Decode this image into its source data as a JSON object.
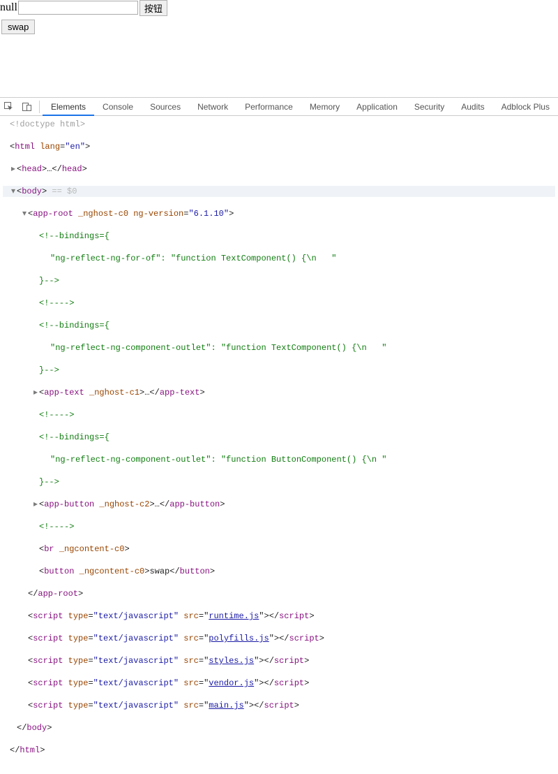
{
  "top": {
    "null_label": "null",
    "input_value": "",
    "btn_label": "按钮",
    "swap_label": "swap"
  },
  "devtools": {
    "tabs": [
      "Elements",
      "Console",
      "Sources",
      "Network",
      "Performance",
      "Memory",
      "Application",
      "Security",
      "Audits",
      "Adblock Plus"
    ],
    "active_tab_index": 0,
    "source_lines": [
      {
        "ind": 0,
        "caret": "",
        "seg": [
          {
            "c": "cgray",
            "t": "<!doctype html>"
          }
        ]
      },
      {
        "ind": 0,
        "caret": "",
        "seg": [
          {
            "c": "",
            "t": "<"
          },
          {
            "c": "ctag",
            "t": "html"
          },
          {
            "c": "",
            "t": " "
          },
          {
            "c": "cattrname",
            "t": "lang"
          },
          {
            "c": "",
            "t": "="
          },
          {
            "c": "cattrval",
            "t": "\"en\""
          },
          {
            "c": "",
            "t": ">"
          }
        ]
      },
      {
        "ind": 1,
        "caret": "▸",
        "seg": [
          {
            "c": "",
            "t": "<"
          },
          {
            "c": "ctag",
            "t": "head"
          },
          {
            "c": "",
            "t": ">…</"
          },
          {
            "c": "ctag",
            "t": "head"
          },
          {
            "c": "",
            "t": ">"
          }
        ]
      },
      {
        "ind": 1,
        "caret": "▾",
        "hl": true,
        "seg": [
          {
            "c": "",
            "t": "<"
          },
          {
            "c": "ctag",
            "t": "body"
          },
          {
            "c": "",
            "t": ">"
          },
          {
            "c": "sel-dim",
            "t": " == $0"
          }
        ]
      },
      {
        "ind": 2,
        "caret": "▾",
        "seg": [
          {
            "c": "",
            "t": "<"
          },
          {
            "c": "ctag",
            "t": "app-root"
          },
          {
            "c": "",
            "t": " "
          },
          {
            "c": "cattrname",
            "t": "_nghost-c0"
          },
          {
            "c": "",
            "t": " "
          },
          {
            "c": "cattrname",
            "t": "ng-version"
          },
          {
            "c": "",
            "t": "="
          },
          {
            "c": "cattrval",
            "t": "\"6.1.10\""
          },
          {
            "c": "",
            "t": ">"
          }
        ]
      },
      {
        "ind": 3,
        "caret": "",
        "seg": [
          {
            "c": "ccomment",
            "t": "<!--bindings={"
          }
        ]
      },
      {
        "ind": 4,
        "caret": "",
        "seg": [
          {
            "c": "ccomment",
            "t": "\"ng-reflect-ng-for-of\": \"function TextComponent() {\\n   \""
          }
        ]
      },
      {
        "ind": 3,
        "caret": "",
        "seg": [
          {
            "c": "ccomment",
            "t": "}-->"
          }
        ]
      },
      {
        "ind": 3,
        "caret": "",
        "seg": [
          {
            "c": "ccomment",
            "t": "<!---->"
          }
        ]
      },
      {
        "ind": 3,
        "caret": "",
        "seg": [
          {
            "c": "ccomment",
            "t": "<!--bindings={"
          }
        ]
      },
      {
        "ind": 4,
        "caret": "",
        "seg": [
          {
            "c": "ccomment",
            "t": "\"ng-reflect-ng-component-outlet\": \"function TextComponent() {\\n   \""
          }
        ]
      },
      {
        "ind": 3,
        "caret": "",
        "seg": [
          {
            "c": "ccomment",
            "t": "}-->"
          }
        ]
      },
      {
        "ind": 3,
        "caret": "▸",
        "seg": [
          {
            "c": "",
            "t": "<"
          },
          {
            "c": "ctag",
            "t": "app-text"
          },
          {
            "c": "",
            "t": " "
          },
          {
            "c": "cattrname",
            "t": "_nghost-c1"
          },
          {
            "c": "",
            "t": ">…</"
          },
          {
            "c": "ctag",
            "t": "app-text"
          },
          {
            "c": "",
            "t": ">"
          }
        ]
      },
      {
        "ind": 3,
        "caret": "",
        "seg": [
          {
            "c": "ccomment",
            "t": "<!---->"
          }
        ]
      },
      {
        "ind": 3,
        "caret": "",
        "seg": [
          {
            "c": "ccomment",
            "t": "<!--bindings={"
          }
        ]
      },
      {
        "ind": 4,
        "caret": "",
        "seg": [
          {
            "c": "ccomment",
            "t": "\"ng-reflect-ng-component-outlet\": \"function ButtonComponent() {\\n \""
          }
        ]
      },
      {
        "ind": 3,
        "caret": "",
        "seg": [
          {
            "c": "ccomment",
            "t": "}-->"
          }
        ]
      },
      {
        "ind": 3,
        "caret": "▸",
        "seg": [
          {
            "c": "",
            "t": "<"
          },
          {
            "c": "ctag",
            "t": "app-button"
          },
          {
            "c": "",
            "t": " "
          },
          {
            "c": "cattrname",
            "t": "_nghost-c2"
          },
          {
            "c": "",
            "t": ">…</"
          },
          {
            "c": "ctag",
            "t": "app-button"
          },
          {
            "c": "",
            "t": ">"
          }
        ]
      },
      {
        "ind": 3,
        "caret": "",
        "seg": [
          {
            "c": "ccomment",
            "t": "<!---->"
          }
        ]
      },
      {
        "ind": 3,
        "caret": "",
        "seg": [
          {
            "c": "",
            "t": "<"
          },
          {
            "c": "ctag",
            "t": "br"
          },
          {
            "c": "",
            "t": " "
          },
          {
            "c": "cattrname",
            "t": "_ngcontent-c0"
          },
          {
            "c": "",
            "t": ">"
          }
        ]
      },
      {
        "ind": 3,
        "caret": "",
        "seg": [
          {
            "c": "",
            "t": "<"
          },
          {
            "c": "ctag",
            "t": "button"
          },
          {
            "c": "",
            "t": " "
          },
          {
            "c": "cattrname",
            "t": "_ngcontent-c0"
          },
          {
            "c": "",
            "t": ">swap</"
          },
          {
            "c": "ctag",
            "t": "button"
          },
          {
            "c": "",
            "t": ">"
          }
        ]
      },
      {
        "ind": 2,
        "caret": "",
        "seg": [
          {
            "c": "",
            "t": "</"
          },
          {
            "c": "ctag",
            "t": "app-root"
          },
          {
            "c": "",
            "t": ">"
          }
        ]
      },
      {
        "ind": 2,
        "caret": "",
        "seg": [
          {
            "c": "",
            "t": "<"
          },
          {
            "c": "ctag",
            "t": "script"
          },
          {
            "c": "",
            "t": " "
          },
          {
            "c": "cattrname",
            "t": "type"
          },
          {
            "c": "",
            "t": "="
          },
          {
            "c": "cattrval",
            "t": "\"text/javascript\""
          },
          {
            "c": "",
            "t": " "
          },
          {
            "c": "cattrname",
            "t": "src"
          },
          {
            "c": "",
            "t": "=\""
          },
          {
            "c": "cattrval cunder",
            "t": "runtime.js"
          },
          {
            "c": "",
            "t": "\"></"
          },
          {
            "c": "ctag",
            "t": "script"
          },
          {
            "c": "",
            "t": ">"
          }
        ]
      },
      {
        "ind": 2,
        "caret": "",
        "seg": [
          {
            "c": "",
            "t": "<"
          },
          {
            "c": "ctag",
            "t": "script"
          },
          {
            "c": "",
            "t": " "
          },
          {
            "c": "cattrname",
            "t": "type"
          },
          {
            "c": "",
            "t": "="
          },
          {
            "c": "cattrval",
            "t": "\"text/javascript\""
          },
          {
            "c": "",
            "t": " "
          },
          {
            "c": "cattrname",
            "t": "src"
          },
          {
            "c": "",
            "t": "=\""
          },
          {
            "c": "cattrval cunder",
            "t": "polyfills.js"
          },
          {
            "c": "",
            "t": "\"></"
          },
          {
            "c": "ctag",
            "t": "script"
          },
          {
            "c": "",
            "t": ">"
          }
        ]
      },
      {
        "ind": 2,
        "caret": "",
        "seg": [
          {
            "c": "",
            "t": "<"
          },
          {
            "c": "ctag",
            "t": "script"
          },
          {
            "c": "",
            "t": " "
          },
          {
            "c": "cattrname",
            "t": "type"
          },
          {
            "c": "",
            "t": "="
          },
          {
            "c": "cattrval",
            "t": "\"text/javascript\""
          },
          {
            "c": "",
            "t": " "
          },
          {
            "c": "cattrname",
            "t": "src"
          },
          {
            "c": "",
            "t": "=\""
          },
          {
            "c": "cattrval cunder",
            "t": "styles.js"
          },
          {
            "c": "",
            "t": "\"></"
          },
          {
            "c": "ctag",
            "t": "script"
          },
          {
            "c": "",
            "t": ">"
          }
        ]
      },
      {
        "ind": 2,
        "caret": "",
        "seg": [
          {
            "c": "",
            "t": "<"
          },
          {
            "c": "ctag",
            "t": "script"
          },
          {
            "c": "",
            "t": " "
          },
          {
            "c": "cattrname",
            "t": "type"
          },
          {
            "c": "",
            "t": "="
          },
          {
            "c": "cattrval",
            "t": "\"text/javascript\""
          },
          {
            "c": "",
            "t": " "
          },
          {
            "c": "cattrname",
            "t": "src"
          },
          {
            "c": "",
            "t": "=\""
          },
          {
            "c": "cattrval cunder",
            "t": "vendor.js"
          },
          {
            "c": "",
            "t": "\"></"
          },
          {
            "c": "ctag",
            "t": "script"
          },
          {
            "c": "",
            "t": ">"
          }
        ]
      },
      {
        "ind": 2,
        "caret": "",
        "seg": [
          {
            "c": "",
            "t": "<"
          },
          {
            "c": "ctag",
            "t": "script"
          },
          {
            "c": "",
            "t": " "
          },
          {
            "c": "cattrname",
            "t": "type"
          },
          {
            "c": "",
            "t": "="
          },
          {
            "c": "cattrval",
            "t": "\"text/javascript\""
          },
          {
            "c": "",
            "t": " "
          },
          {
            "c": "cattrname",
            "t": "src"
          },
          {
            "c": "",
            "t": "=\""
          },
          {
            "c": "cattrval cunder",
            "t": "main.js"
          },
          {
            "c": "",
            "t": "\"></"
          },
          {
            "c": "ctag",
            "t": "script"
          },
          {
            "c": "",
            "t": ">"
          }
        ]
      },
      {
        "ind": 1,
        "caret": "",
        "seg": [
          {
            "c": "",
            "t": "</"
          },
          {
            "c": "ctag",
            "t": "body"
          },
          {
            "c": "",
            "t": ">"
          }
        ]
      },
      {
        "ind": 0,
        "caret": "",
        "seg": [
          {
            "c": "",
            "t": "</"
          },
          {
            "c": "ctag",
            "t": "html"
          },
          {
            "c": "",
            "t": ">"
          }
        ]
      }
    ]
  }
}
